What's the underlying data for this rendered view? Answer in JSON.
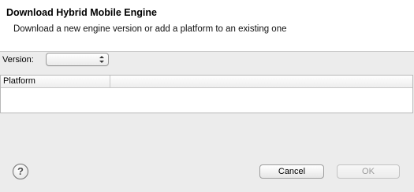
{
  "header": {
    "title": "Download Hybrid Mobile Engine",
    "description": "Download a new engine version or add a platform to an existing one"
  },
  "version": {
    "label": "Version:",
    "value": ""
  },
  "table": {
    "columns": [
      "Platform",
      ""
    ],
    "rows": []
  },
  "buttons": {
    "cancel": "Cancel",
    "ok": "OK",
    "ok_enabled": false
  },
  "icons": {
    "help": "help-icon",
    "select_arrows": "up-down-arrows-icon"
  }
}
